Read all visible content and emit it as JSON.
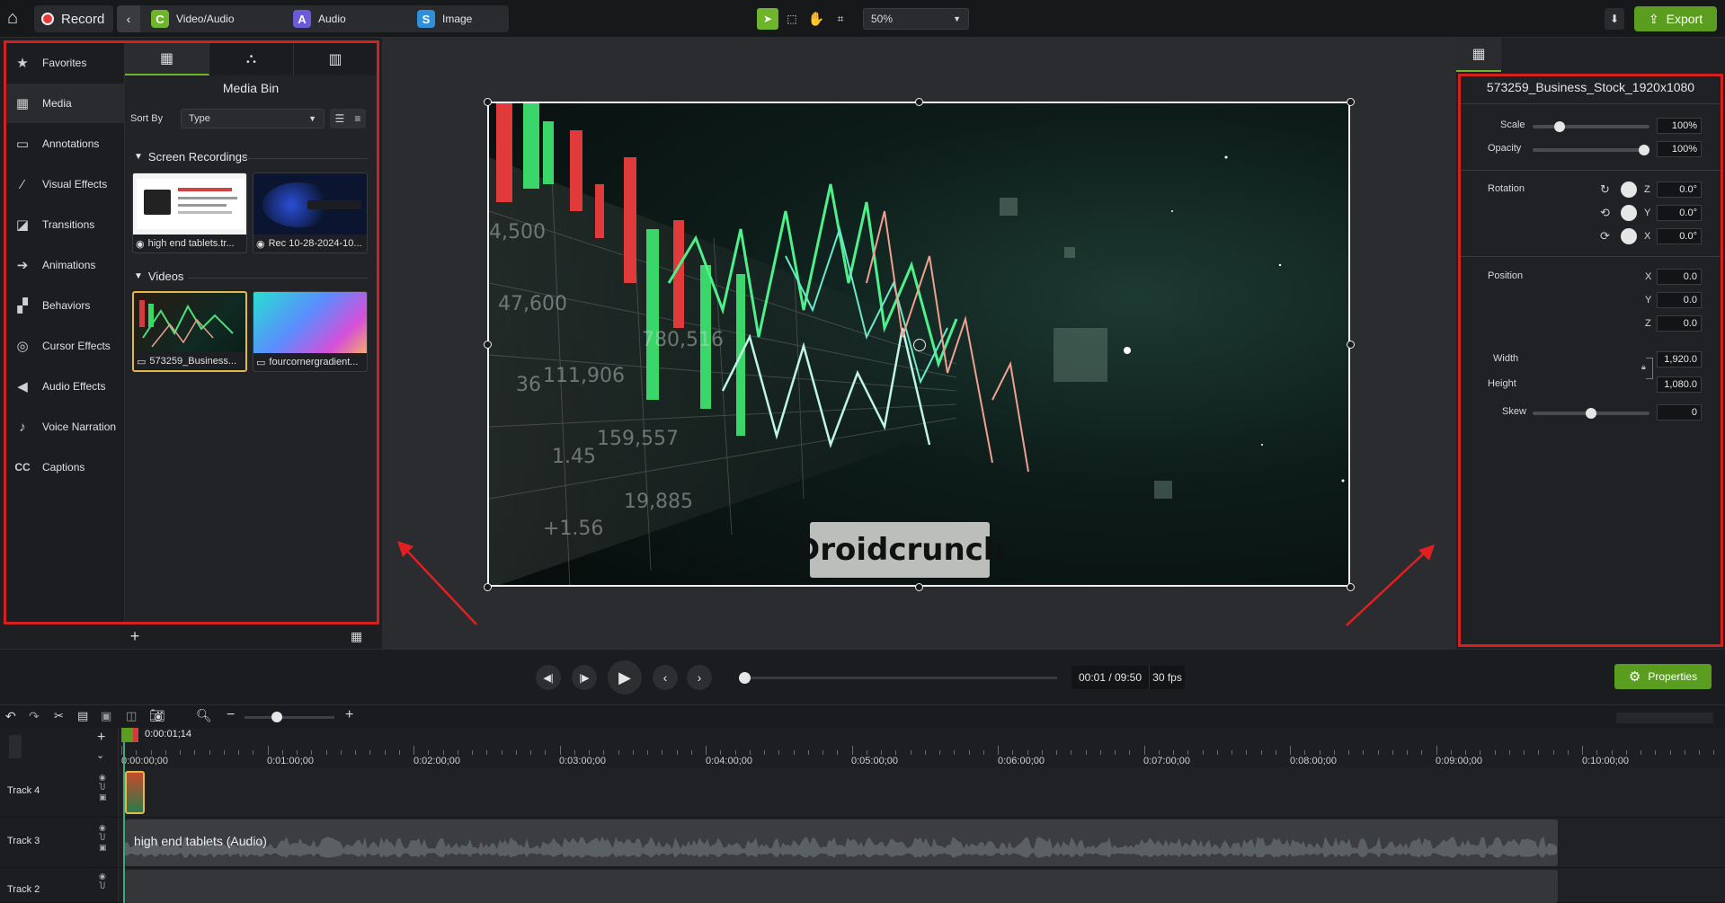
{
  "topbar": {
    "record_label": "Record",
    "tabs": [
      {
        "label": "Video/Audio",
        "icon": "C",
        "color": "#6fb52c"
      },
      {
        "label": "Audio",
        "icon": "A",
        "color": "#6a5bd6"
      },
      {
        "label": "Image",
        "icon": "S",
        "color": "#2f8fd8"
      }
    ],
    "zoom": "50%",
    "export_label": "Export"
  },
  "sidebar": {
    "items": [
      {
        "label": "Favorites",
        "icon": "★"
      },
      {
        "label": "Media",
        "icon": "▦"
      },
      {
        "label": "Annotations",
        "icon": "▭"
      },
      {
        "label": "Visual Effects",
        "icon": "⁄"
      },
      {
        "label": "Transitions",
        "icon": "◪"
      },
      {
        "label": "Animations",
        "icon": "➔"
      },
      {
        "label": "Behaviors",
        "icon": "▞"
      },
      {
        "label": "Cursor Effects",
        "icon": "◎"
      },
      {
        "label": "Audio Effects",
        "icon": "◀"
      },
      {
        "label": "Voice Narration",
        "icon": "♪"
      },
      {
        "label": "Captions",
        "icon": "CC"
      }
    ]
  },
  "media_bin": {
    "title": "Media Bin",
    "sort_by_label": "Sort By",
    "sort_value": "Type",
    "sections": [
      {
        "title": "Screen Recordings",
        "items": [
          {
            "name": "high end tablets.tr..."
          },
          {
            "name": "Rec 10-28-2024-10..."
          }
        ]
      },
      {
        "title": "Videos",
        "items": [
          {
            "name": "573259_Business..."
          },
          {
            "name": "fourcornergradient..."
          }
        ]
      }
    ]
  },
  "canvas": {
    "watermark": "Droidcrunch"
  },
  "properties": {
    "title": "573259_Business_Stock_1920x1080",
    "scale_label": "Scale",
    "scale_value": "100%",
    "scale_level": 0.2,
    "opacity_label": "Opacity",
    "opacity_value": "100%",
    "opacity_level": 1.0,
    "rotation_label": "Rotation",
    "rot_z_label": "Z",
    "rot_z": "0.0°",
    "rot_y_label": "Y",
    "rot_y": "0.0°",
    "rot_x_label": "X",
    "rot_x": "0.0°",
    "position_label": "Position",
    "pos_x_label": "X",
    "pos_x": "0.0",
    "pos_y_label": "Y",
    "pos_y": "0.0",
    "pos_z_label": "Z",
    "pos_z": "0.0",
    "width_label": "Width",
    "width": "1,920.0",
    "height_label": "Height",
    "height": "1,080.0",
    "skew_label": "Skew",
    "skew": "0",
    "skew_level": 0.5,
    "button_label": "Properties"
  },
  "playback": {
    "time": "00:01 / 09:50",
    "fps": "30 fps",
    "progress": 0.0
  },
  "timeline": {
    "playhead_time": "0:00:01;14",
    "ticks": [
      "0:00:00;00",
      "0:01:00;00",
      "0:02:00;00",
      "0:03:00;00",
      "0:04:00;00",
      "0:05:00;00",
      "0:06:00;00",
      "0:07:00;00",
      "0:08:00;00",
      "0:09:00;00",
      "0:10:00;00"
    ],
    "tracks": [
      {
        "name": "Track 4",
        "clip": ""
      },
      {
        "name": "Track 3",
        "clip": "high end tablets (Audio)"
      },
      {
        "name": "Track 2",
        "clip": ""
      }
    ]
  }
}
